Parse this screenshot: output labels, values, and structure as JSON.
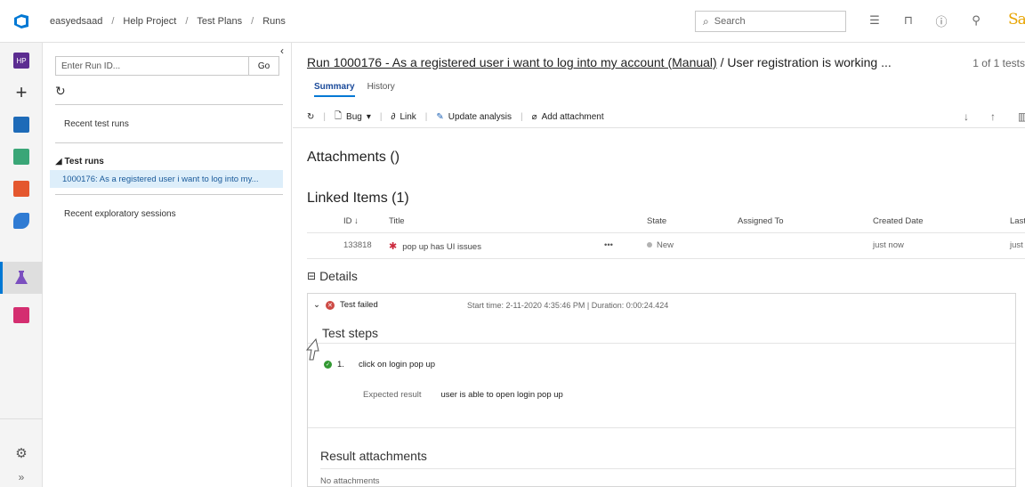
{
  "topbar": {
    "breadcrumb": [
      "easyedsaad",
      "Help Project",
      "Test Plans",
      "Runs"
    ],
    "breadcrumb_sep": "/",
    "search_placeholder": "Search",
    "avatar_text": [
      "Sa",
      "a"
    ]
  },
  "rail": {
    "project_badge": "HP",
    "accent": "#0078d4"
  },
  "panel": {
    "runid_placeholder": "Enter Run ID...",
    "go_label": "Go",
    "recent_runs_label": "Recent test runs",
    "test_runs_group": "Test runs",
    "selected_run": "1000176: As a registered user i want to log into my...",
    "recent_sessions_label": "Recent exploratory sessions"
  },
  "main": {
    "run_title_link": "Run 1000176 - As a registered user i want to log into my account (Manual)",
    "run_title_rest": " / User registration is working ...",
    "run_count": "1 of 1 tests",
    "tabs": [
      {
        "label": "Summary"
      },
      {
        "label": "History"
      }
    ],
    "toolbar": {
      "bug_label": "Bug",
      "link_label": "Link",
      "update_label": "Update analysis",
      "attach_label": "Add attachment"
    },
    "attachments_title": "Attachments ()",
    "linked_title": "Linked Items (1)",
    "linked_columns": [
      "ID",
      "Title",
      "State",
      "Assigned To",
      "Created Date",
      "Last"
    ],
    "linked_rows": [
      {
        "id": "133818",
        "title": "pop up has UI issues",
        "more": "•••",
        "state": "New",
        "assigned": "",
        "created": "just now",
        "last": "just"
      }
    ],
    "details_title": "Details",
    "status": "Test failed",
    "meta": "Start time: 2-11-2020 4:35:46 PM | Duration: 0:00:24.424",
    "steps_title": "Test steps",
    "steps": [
      {
        "index": "1.",
        "action": "click on login pop up",
        "expected_label": "Expected result",
        "expected": "user is able to open login pop up"
      }
    ],
    "results_title": "Result attachments",
    "no_attachments": "No attachments"
  }
}
